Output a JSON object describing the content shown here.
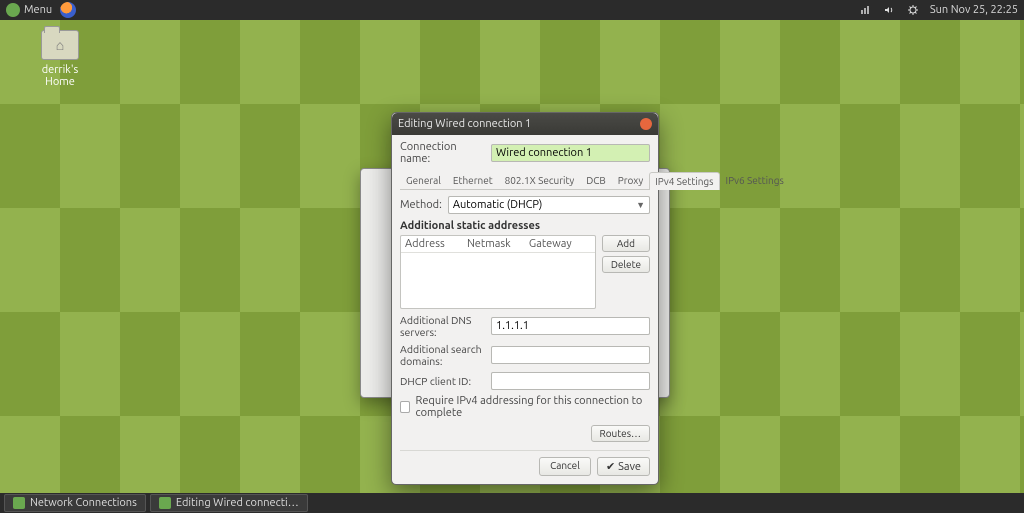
{
  "panel": {
    "menu_label": "Menu",
    "clock": "Sun Nov 25, 22:25"
  },
  "desktop": {
    "home_label": "derrik's Home"
  },
  "dialog": {
    "title": "Editing Wired connection 1",
    "conn_name_label": "Connection name:",
    "conn_name_value": "Wired connection 1",
    "tabs": {
      "general": "General",
      "ethernet": "Ethernet",
      "security": "802.1X Security",
      "dcb": "DCB",
      "proxy": "Proxy",
      "ipv4": "IPv4 Settings",
      "ipv6": "IPv6 Settings"
    },
    "method_label": "Method:",
    "method_value": "Automatic (DHCP)",
    "addresses_title": "Additional static addresses",
    "col_address": "Address",
    "col_netmask": "Netmask",
    "col_gateway": "Gateway",
    "add_btn": "Add",
    "delete_btn": "Delete",
    "dns_label": "Additional DNS servers:",
    "dns_value": "1.1.1.1",
    "search_label": "Additional search domains:",
    "search_value": "",
    "dhcp_label": "DHCP client ID:",
    "dhcp_value": "",
    "require_label": "Require IPv4 addressing for this connection to complete",
    "routes_btn": "Routes…",
    "cancel_btn": "Cancel",
    "save_btn": "Save"
  },
  "taskbar": {
    "task1": "Network Connections",
    "task2": "Editing Wired connecti…"
  }
}
